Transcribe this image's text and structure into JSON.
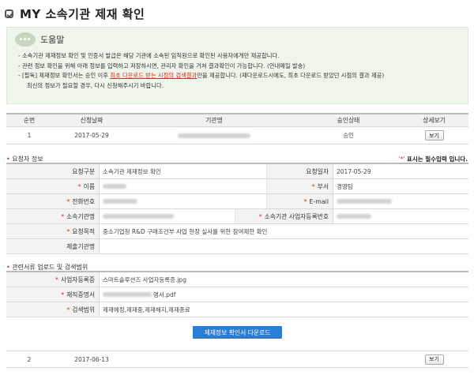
{
  "page": {
    "title": "MY 소속기관 제재 확인"
  },
  "help": {
    "title": "도움말",
    "line1": "- 소속기관 제재정보 확인 및 인증서 발급은 해당 기관에 소속된 임직원으로 확인된 사용자에게만 제공합니다.",
    "line2": "- 관련 정보 확인을 위해 아래 정보를 입력하고 저장하시면, 관리자 확인을 거쳐 결과확인이 가능합니다. (안내메일 발송)",
    "line3_pre": "- [필독] 제재정보 확인서는 승인 이후 ",
    "line3_highlight": "최초 다운로드 받는 시점의 검색결과",
    "line3_post": "만을 제공합니다. (재다운로드시에도, 최초 다운로드 받았던 시점의 결과 제공)",
    "line4": "최신의 정보가 필요할 경우, 다시 신청해주시기 바랍니다."
  },
  "list": {
    "headers": [
      "순번",
      "신청날짜",
      "기관명",
      "승인상태",
      "상세보기"
    ],
    "rows": [
      {
        "no": "1",
        "date": "2017-05-29",
        "status": "승인",
        "button": "보기"
      },
      {
        "no": "2",
        "date": "2017-06-13",
        "status": "",
        "button": "보기"
      }
    ]
  },
  "requester": {
    "section_title": "요청자 정보",
    "required_star": "'*'",
    "required_note": "표시는 필수입력 입니다.",
    "labels": {
      "req_type": "요청구분",
      "req_date": "요청일자",
      "name": "이름",
      "dept": "부서",
      "phone": "전화번호",
      "email": "E-mail",
      "org_name": "소속기관명",
      "biz_no": "소속기관 사업자등록번호",
      "purpose": "요청목적",
      "submit_org": "제출기관명"
    },
    "values": {
      "req_type": "소속기관 제재정보 확인",
      "req_date": "2017-05-29",
      "dept": "경영팀",
      "purpose": "중소기업청 R&D 구매조건부 사업 현장 실사를 위한 참여제한 확인",
      "submit_org": ""
    }
  },
  "docs": {
    "section_title": "관련서류 업로드 및 검색범위",
    "labels": {
      "biz_cert": "사업자등록증",
      "employ_cert": "재직증명서",
      "scope": "검색범위"
    },
    "values": {
      "biz_cert": "스마트솔루션즈 사업자등록증.jpg",
      "employ_cert_suffix": "명서.pdf",
      "scope": "제재예정,제재중,제재해지,제재종료"
    }
  },
  "download_button": "제재정보 확인서 다운로드",
  "colors": {
    "accent": "#2a7dd4",
    "required": "#d92d1f",
    "help_bg": "#eef5ea"
  }
}
